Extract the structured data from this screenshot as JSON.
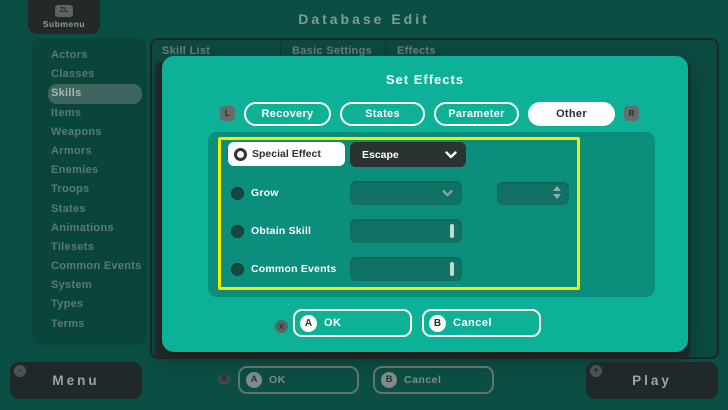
{
  "top_bar": {
    "submenu_button": {
      "shortcut": "ZL",
      "label": "Submenu"
    },
    "title": "Database Edit"
  },
  "sidebar": {
    "items": [
      {
        "label": "Actors",
        "selected": false
      },
      {
        "label": "Classes",
        "selected": false
      },
      {
        "label": "Skills",
        "selected": true
      },
      {
        "label": "Items",
        "selected": false
      },
      {
        "label": "Weapons",
        "selected": false
      },
      {
        "label": "Armors",
        "selected": false
      },
      {
        "label": "Enemies",
        "selected": false
      },
      {
        "label": "Troops",
        "selected": false
      },
      {
        "label": "States",
        "selected": false
      },
      {
        "label": "Animations",
        "selected": false
      },
      {
        "label": "Tilesets",
        "selected": false
      },
      {
        "label": "Common Events",
        "selected": false
      },
      {
        "label": "System",
        "selected": false
      },
      {
        "label": "Types",
        "selected": false
      },
      {
        "label": "Terms",
        "selected": false
      }
    ]
  },
  "background_panel": {
    "column_headers": [
      "Skill List",
      "Basic Settings",
      "Effects"
    ]
  },
  "dialog": {
    "title": "Set Effects",
    "left_shoulder": "L",
    "right_shoulder": "R",
    "tabs": [
      {
        "label": "Recovery",
        "selected": false
      },
      {
        "label": "States",
        "selected": false
      },
      {
        "label": "Parameter",
        "selected": false
      },
      {
        "label": "Other",
        "selected": true
      }
    ],
    "rows": [
      {
        "label": "Special Effect",
        "selected": true,
        "control": "dropdown",
        "value": "Escape"
      },
      {
        "label": "Grow",
        "selected": false,
        "control": "dropdown-with-spinner",
        "value": "",
        "spinner_value": ""
      },
      {
        "label": "Obtain Skill",
        "selected": false,
        "control": "text-input",
        "value": ""
      },
      {
        "label": "Common Events",
        "selected": false,
        "control": "text-input",
        "value": ""
      }
    ],
    "highlight_color": "#F4EA00",
    "accent_color": "#0CB197",
    "buttons": {
      "x_hint": "X",
      "ok": {
        "badge": "A",
        "label": "OK"
      },
      "cancel": {
        "badge": "B",
        "label": "Cancel"
      }
    }
  },
  "bottom_bar": {
    "menu_button": {
      "badge": "-",
      "label": "Menu"
    },
    "x_hint": "X",
    "ok": {
      "badge": "A",
      "label": "OK"
    },
    "cancel": {
      "badge": "B",
      "label": "Cancel"
    },
    "play_button": {
      "badge": "+",
      "label": "Play"
    }
  }
}
